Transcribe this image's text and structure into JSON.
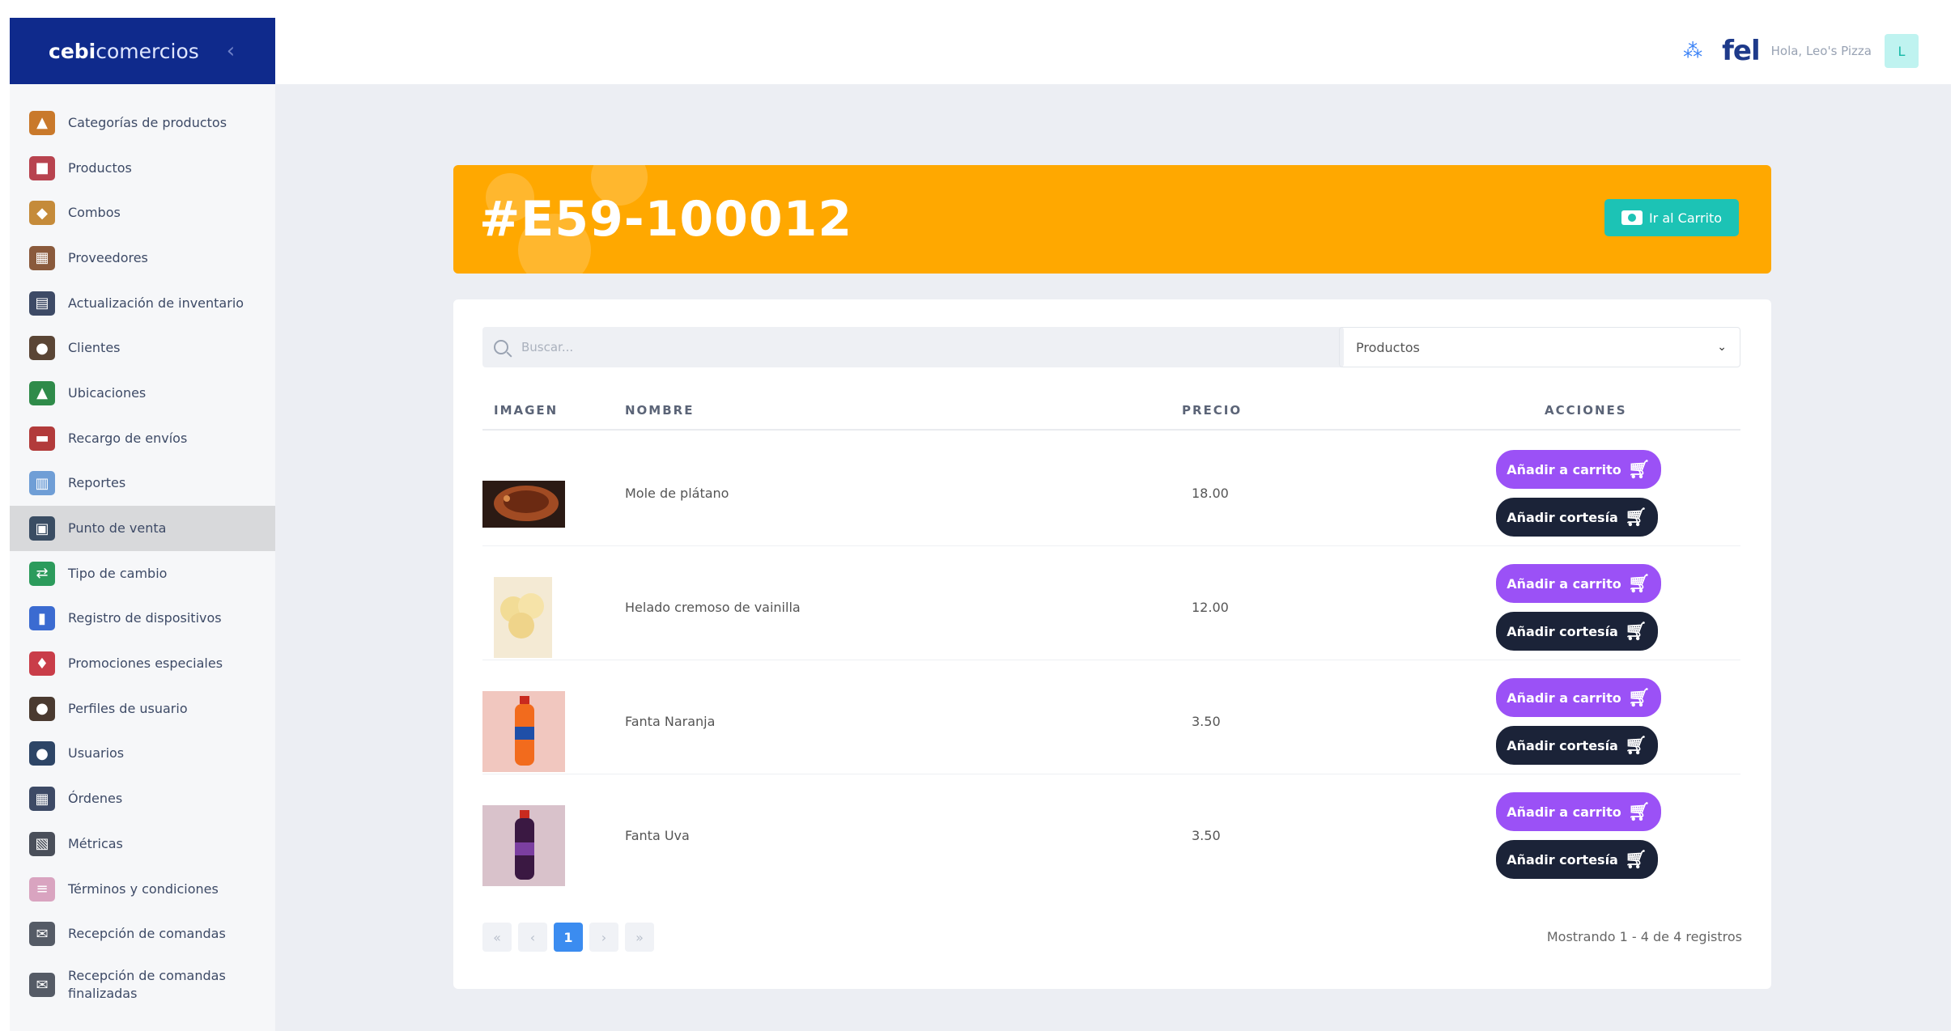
{
  "brand": {
    "part1": "ebi",
    "part2": "comercios",
    "prefix": "c"
  },
  "sidebar": {
    "items": [
      {
        "label": "Categorías de productos",
        "icon": "categories-icon",
        "color": "#c9792b"
      },
      {
        "label": "Productos",
        "icon": "products-icon",
        "color": "#b8434f"
      },
      {
        "label": "Combos",
        "icon": "combos-icon",
        "color": "#c58b3a"
      },
      {
        "label": "Proveedores",
        "icon": "suppliers-icon",
        "color": "#8a5a3c"
      },
      {
        "label": "Actualización de inventario",
        "icon": "inventory-icon",
        "color": "#3d4a66"
      },
      {
        "label": "Clientes",
        "icon": "clients-icon",
        "color": "#5a4535"
      },
      {
        "label": "Ubicaciones",
        "icon": "locations-icon",
        "color": "#2f8b4a"
      },
      {
        "label": "Recargo de envíos",
        "icon": "shipping-icon",
        "color": "#b23b3b"
      },
      {
        "label": "Reportes",
        "icon": "reports-icon",
        "color": "#6f9ed6"
      },
      {
        "label": "Punto de venta",
        "icon": "pos-icon",
        "color": "#3a4d63"
      },
      {
        "label": "Tipo de cambio",
        "icon": "exchange-icon",
        "color": "#2c9b5c"
      },
      {
        "label": "Registro de dispositivos",
        "icon": "devices-icon",
        "color": "#3b6bd1"
      },
      {
        "label": "Promociones especiales",
        "icon": "promotions-icon",
        "color": "#c93d49"
      },
      {
        "label": "Perfiles de usuario",
        "icon": "user-profiles-icon",
        "color": "#4a3a30"
      },
      {
        "label": "Usuarios",
        "icon": "users-icon",
        "color": "#2d4566"
      },
      {
        "label": "Órdenes",
        "icon": "orders-icon",
        "color": "#3d4a66"
      },
      {
        "label": "Métricas",
        "icon": "metrics-icon",
        "color": "#4a4f5a"
      },
      {
        "label": "Términos y condiciones",
        "icon": "terms-icon",
        "color": "#d9a4c0"
      },
      {
        "label": "Recepción de comandas",
        "icon": "command-reception-icon",
        "color": "#555b66"
      },
      {
        "label": "Recepción de comandas finalizadas",
        "icon": "command-finished-icon",
        "color": "#555b66"
      }
    ],
    "active_index": 9
  },
  "topbar": {
    "fel_logo": "fel",
    "greeting": "Hola, Leo's Pizza",
    "avatar_initial": "L"
  },
  "banner": {
    "order_code": "#E59-100012",
    "cart_button": "Ir al Carrito",
    "color": "#ffa800"
  },
  "search": {
    "placeholder": "Buscar..."
  },
  "filter": {
    "selected": "Productos"
  },
  "table": {
    "headers": {
      "image": "IMAGEN",
      "name": "NOMBRE",
      "price": "PRECIO",
      "actions": "ACCIONES"
    },
    "rows": [
      {
        "name": "Mole de plátano",
        "price": "18.00"
      },
      {
        "name": "Helado cremoso de vainilla",
        "price": "12.00"
      },
      {
        "name": "Fanta Naranja",
        "price": "3.50"
      },
      {
        "name": "Fanta Uva",
        "price": "3.50"
      }
    ],
    "add_to_cart": "Añadir a carrito",
    "add_courtesy": "Añadir cortesía"
  },
  "pagination": {
    "first": "«",
    "prev": "‹",
    "current": "1",
    "next": "›",
    "last": "»",
    "summary": "Mostrando 1 - 4 de 4 registros"
  }
}
